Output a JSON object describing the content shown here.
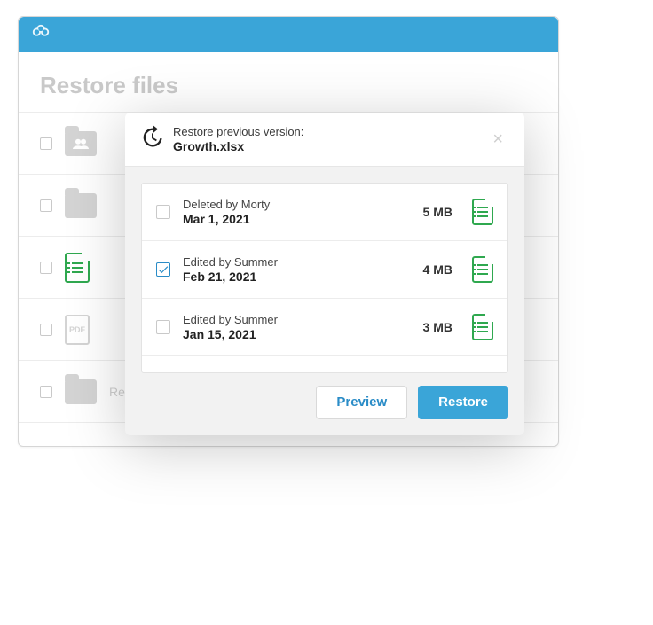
{
  "brand": {
    "name": "Egnyte"
  },
  "page": {
    "title": "Restore files"
  },
  "files": [
    {
      "kind": "shared-folder",
      "label": ""
    },
    {
      "kind": "folder",
      "label": ""
    },
    {
      "kind": "spreadsheet",
      "label": ""
    },
    {
      "kind": "pdf",
      "label": "PDF"
    },
    {
      "kind": "folder",
      "label": "Research"
    }
  ],
  "modal": {
    "title": "Restore previous version:",
    "filename": "Growth.xlsx",
    "versions": [
      {
        "action": "Deleted by Morty",
        "date": "Mar 1, 2021",
        "size": "5 MB",
        "checked": false
      },
      {
        "action": "Edited by Summer",
        "date": "Feb 21, 2021",
        "size": "4 MB",
        "checked": true
      },
      {
        "action": "Edited by Summer",
        "date": "Jan 15, 2021",
        "size": "3 MB",
        "checked": false
      }
    ],
    "buttons": {
      "preview": "Preview",
      "restore": "Restore"
    }
  }
}
